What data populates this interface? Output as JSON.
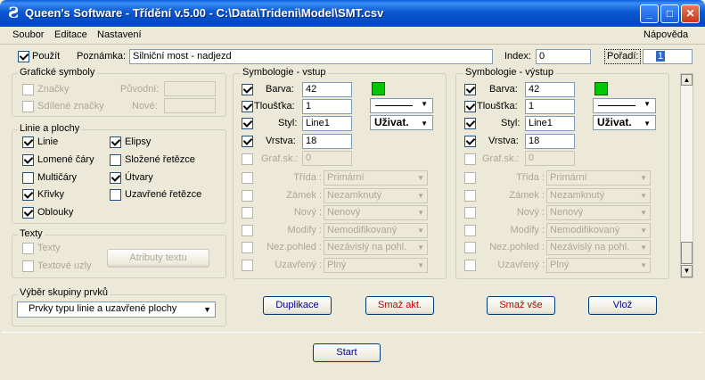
{
  "window": {
    "title": "Queen's Software - Třídění v.5.00 - C:\\Data\\Trideni\\Model\\SMT.csv",
    "icon_glyph": "Ƨ",
    "controls": {
      "minimize": "_",
      "maximize": "□",
      "close": "✕"
    }
  },
  "menu": {
    "soubor": "Soubor",
    "editace": "Editace",
    "nastaveni": "Nastavení",
    "napoveda": "Nápověda"
  },
  "top": {
    "pouzit_label": "Použít",
    "poznamka_label": "Poznámka:",
    "poznamka_value": "Silniční most - nadjezd",
    "index_label": "Index:",
    "index_value": "0",
    "poradi_label": "Pořadí:",
    "poradi_value": "1"
  },
  "graficke": {
    "title": "Grafické symboly",
    "znacky": "Značky",
    "sdilene": "Sdílené značky",
    "puvodni": "Původní:",
    "nove": "Nové:"
  },
  "linie": {
    "title": "Linie a plochy",
    "items": [
      "Linie",
      "Lomené čáry",
      "Multičáry",
      "Křivky",
      "Oblouky",
      "Elipsy",
      "Složené řetězce",
      "Útvary",
      "Uzavřené řetězce"
    ]
  },
  "texty": {
    "title": "Texty",
    "texty": "Texty",
    "textove_uzly": "Textové uzly",
    "atributy": "Atributy textu"
  },
  "vyber": {
    "title": "Výběr skupiny prvků",
    "value": "Prvky typu linie a uzavřené plochy"
  },
  "sym_vstup": {
    "title": "Symbologie - vstup",
    "barva": "Barva:",
    "barva_value": "42",
    "tloustka": "Tloušťka:",
    "tloustka_value": "1",
    "styl": "Styl:",
    "styl_value": "Line1",
    "vrstva": "Vrstva:",
    "vrstva_value": "18",
    "grafsk": "Graf.sk.:",
    "grafsk_value": "0",
    "uzivat": "Uživat.",
    "rows": [
      {
        "label": "Třída :",
        "value": "Primární"
      },
      {
        "label": "Zámek :",
        "value": "Nezamknutý"
      },
      {
        "label": "Nový :",
        "value": "Nenový"
      },
      {
        "label": "Modify :",
        "value": "Nemodifikovaný"
      },
      {
        "label": "Nez.pohled :",
        "value": "Nezávislý na pohl."
      },
      {
        "label": "Uzavřený :",
        "value": "Plný"
      }
    ]
  },
  "sym_vystup": {
    "title": "Symbologie - výstup",
    "barva": "Barva:",
    "barva_value": "42",
    "tloustka": "Tloušťka:",
    "tloustka_value": "1",
    "styl": "Styl:",
    "styl_value": "Line1",
    "vrstva": "Vrstva:",
    "vrstva_value": "18",
    "grafsk": "Graf.sk.:",
    "grafsk_value": "0",
    "uzivat": "Uživat.",
    "rows": [
      {
        "label": "Třída :",
        "value": "Primární"
      },
      {
        "label": "Zámek :",
        "value": "Nezamknutý"
      },
      {
        "label": "Nový :",
        "value": "Nenový"
      },
      {
        "label": "Modify :",
        "value": "Nemodifikovaný"
      },
      {
        "label": "Nez.pohled :",
        "value": "Nezávislý na pohl."
      },
      {
        "label": "Uzavřený :",
        "value": "Plný"
      }
    ]
  },
  "buttons": {
    "duplikace": "Duplikace",
    "smaz_akt": "Smaž akt.",
    "smaz_vse": "Smaž vše",
    "vloz": "Vlož",
    "start": "Start"
  },
  "colors": {
    "swatch": "#00c800",
    "title_bar": "#0a58d0"
  }
}
